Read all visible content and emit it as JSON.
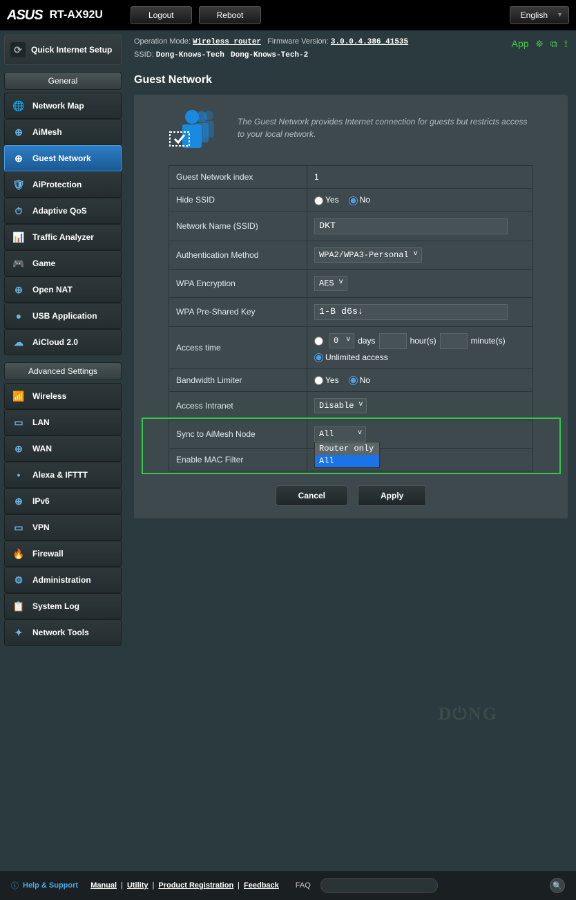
{
  "header": {
    "brand": "ASUS",
    "model": "RT-AX92U",
    "logout": "Logout",
    "reboot": "Reboot",
    "language": "English"
  },
  "info": {
    "op_mode_label": "Operation Mode:",
    "op_mode": "Wireless router",
    "fw_label": "Firmware Version:",
    "fw": "3.0.0.4.386_41535",
    "ssid_label": "SSID:",
    "ssid1": "Dong-Knows-Tech",
    "ssid2": "Dong-Knows-Tech-2",
    "app": "App"
  },
  "sidebar": {
    "qis": "Quick Internet Setup",
    "general_header": "General",
    "general": [
      {
        "label": "Network Map",
        "icon": "🌐"
      },
      {
        "label": "AiMesh",
        "icon": "⊕"
      },
      {
        "label": "Guest Network",
        "icon": "⊕",
        "active": true
      },
      {
        "label": "AiProtection",
        "icon": "🛡"
      },
      {
        "label": "Adaptive QoS",
        "icon": "⏱"
      },
      {
        "label": "Traffic Analyzer",
        "icon": "📊"
      },
      {
        "label": "Game",
        "icon": "🎮"
      },
      {
        "label": "Open NAT",
        "icon": "⊕"
      },
      {
        "label": "USB Application",
        "icon": "●"
      },
      {
        "label": "AiCloud 2.0",
        "icon": "☁"
      }
    ],
    "advanced_header": "Advanced Settings",
    "advanced": [
      {
        "label": "Wireless",
        "icon": "📶"
      },
      {
        "label": "LAN",
        "icon": "▭"
      },
      {
        "label": "WAN",
        "icon": "⊕"
      },
      {
        "label": "Alexa & IFTTT",
        "icon": "•"
      },
      {
        "label": "IPv6",
        "icon": "⊕"
      },
      {
        "label": "VPN",
        "icon": "▭"
      },
      {
        "label": "Firewall",
        "icon": "🔥"
      },
      {
        "label": "Administration",
        "icon": "⚙"
      },
      {
        "label": "System Log",
        "icon": "📋"
      },
      {
        "label": "Network Tools",
        "icon": "✦"
      }
    ]
  },
  "page": {
    "title": "Guest Network",
    "intro": "The Guest Network provides Internet connection for guests but restricts access to your local network."
  },
  "form": {
    "index_label": "Guest Network index",
    "index_value": "1",
    "hide_ssid_label": "Hide SSID",
    "yes": "Yes",
    "no": "No",
    "ssid_label": "Network Name (SSID)",
    "ssid_value": "DKT",
    "auth_label": "Authentication Method",
    "auth_value": "WPA2/WPA3-Personal",
    "enc_label": "WPA Encryption",
    "enc_value": "AES",
    "psk_label": "WPA Pre-Shared Key",
    "psk_value": "1-B d6s↓",
    "access_time_label": "Access time",
    "days_value": "0",
    "days": "days",
    "hours": "hour(s)",
    "minutes": "minute(s)",
    "unlimited": "Unlimited access",
    "bw_label": "Bandwidth Limiter",
    "intranet_label": "Access Intranet",
    "intranet_value": "Disable",
    "sync_label": "Sync to AiMesh Node",
    "sync_value": "All",
    "sync_options": [
      "Router only",
      "All"
    ],
    "mac_label": "Enable MAC Filter",
    "cancel": "Cancel",
    "apply": "Apply"
  },
  "footer": {
    "help": "Help & Support",
    "manual": "Manual",
    "utility": "Utility",
    "product_reg": "Product Registration",
    "feedback": "Feedback",
    "faq": "FAQ"
  }
}
